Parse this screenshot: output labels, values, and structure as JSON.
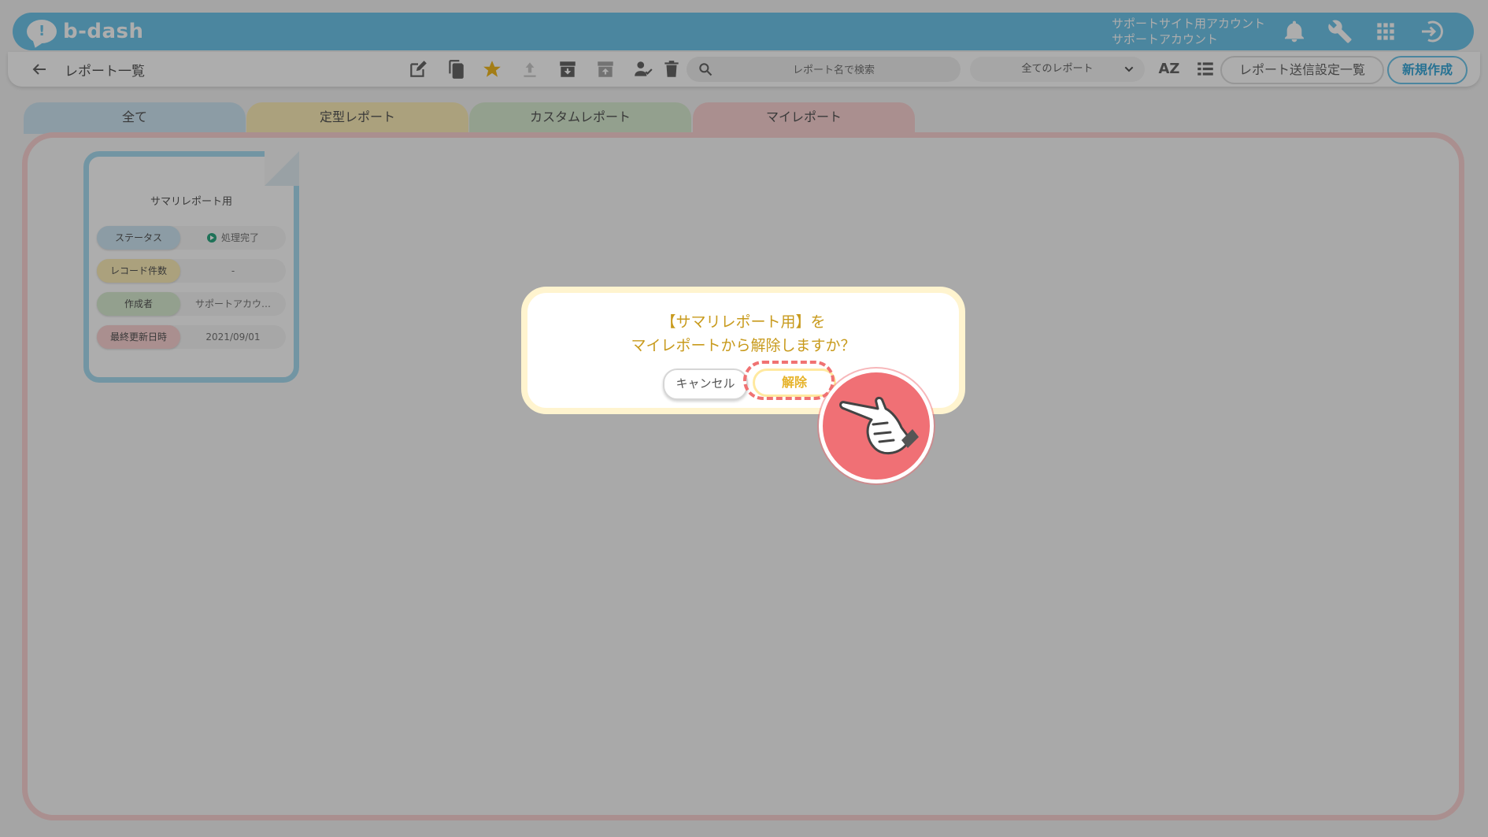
{
  "app": {
    "logo_text": "b-dash",
    "logo_mark": "!",
    "account_line1": "サポートサイト用アカウント",
    "account_line2": "サポートアカウント"
  },
  "toolbar": {
    "page_title": "レポート一覧",
    "search_placeholder": "レポート名で検索",
    "filter_selected": "全てのレポート",
    "sort_label": "AZ",
    "send_settings_label": "レポート送信設定一覧",
    "new_label": "新規作成"
  },
  "tabs": [
    {
      "label": "全て",
      "color": "#cfe6f3"
    },
    {
      "label": "定型レポート",
      "color": "#fdeeb8"
    },
    {
      "label": "カスタムレポート",
      "color": "#d9ecd1"
    },
    {
      "label": "マイレポート",
      "color": "#fbd3d3"
    }
  ],
  "card": {
    "title": "サマリレポート用",
    "rows": [
      {
        "label": "ステータス",
        "value": "処理完了",
        "color": "#cfe6f3"
      },
      {
        "label": "レコード件数",
        "value": "-",
        "color": "#fdeeb8"
      },
      {
        "label": "作成者",
        "value": "サポートアカウ…",
        "color": "#d9ecd1"
      },
      {
        "label": "最終更新日時",
        "value": "2021/09/01",
        "color": "#fbd3d3"
      }
    ]
  },
  "dialog": {
    "line1": "【サマリレポート用】を",
    "line2": "マイレポートから解除しますか？",
    "cancel_label": "キャンセル",
    "confirm_label": "解除"
  },
  "colors": {
    "header": "#6fc6ea",
    "accent_text": "#c89a1c",
    "highlight": "#f07272"
  }
}
